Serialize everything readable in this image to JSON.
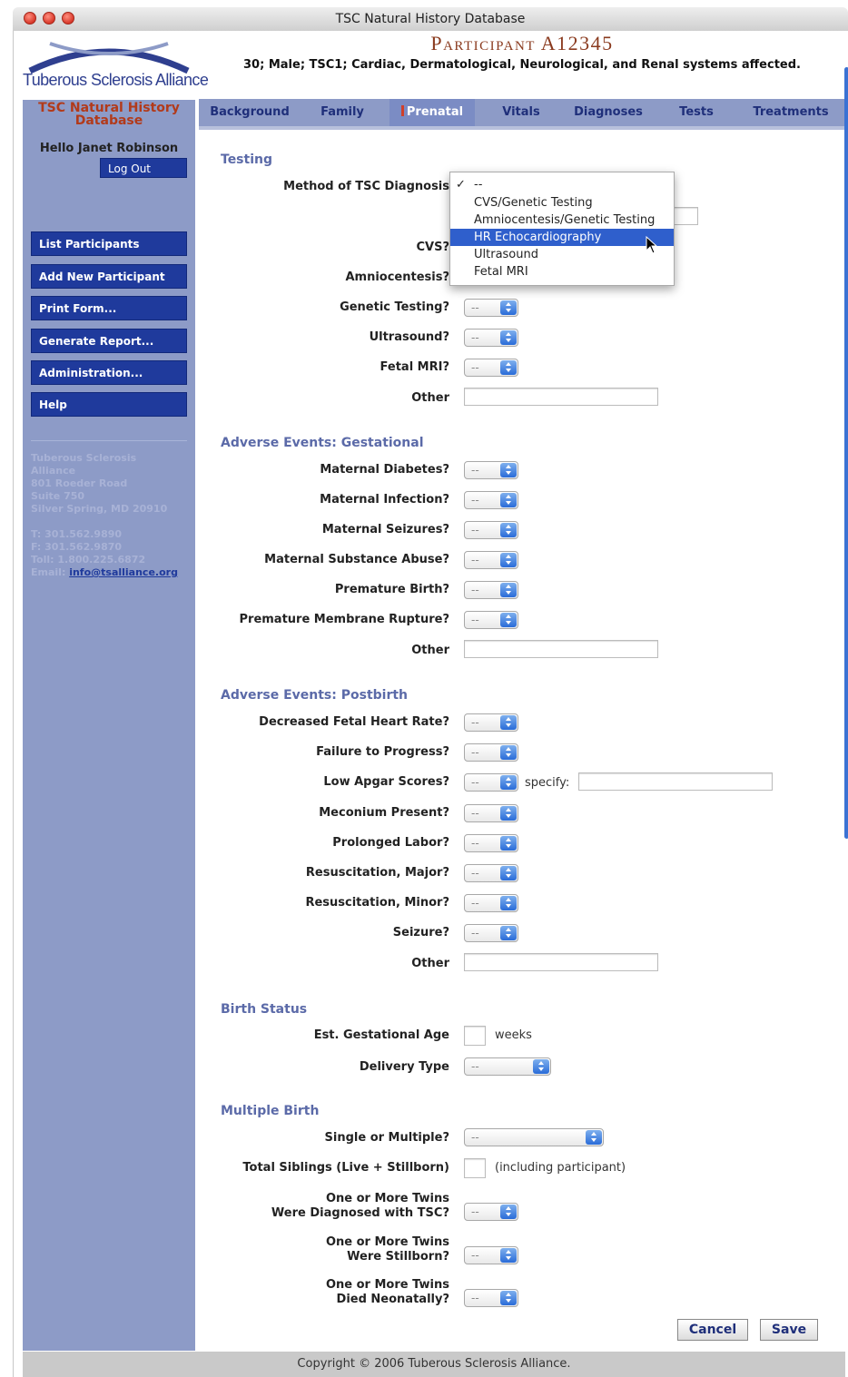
{
  "window": {
    "title": "TSC Natural History Database"
  },
  "header": {
    "logo_text": "Tuberous Sclerosis Alliance",
    "participant_title": "Participant A12345",
    "participant_summary": "30; Male; TSC1; Cardiac, Dermatological, Neurological, and Renal systems affected."
  },
  "sidebar": {
    "db_title_line1": "TSC Natural History",
    "db_title_line2": "Database",
    "hello": "Hello Janet Robinson",
    "logout": "Log Out",
    "nav": [
      "List Participants",
      "Add New Participant",
      "Print Form...",
      "Generate Report...",
      "Administration...",
      "Help"
    ],
    "address": {
      "line1": "Tuberous Sclerosis",
      "line2": "Alliance",
      "line3": "801 Roeder Road",
      "line4": "Suite 750",
      "line5": "Silver Spring, MD 20910",
      "phone": "T: 301.562.9890",
      "fax": "F: 301.562.9870",
      "tollfree": "Toll: 1.800.225.6872",
      "email_label": "Email:",
      "email": "info@tsalliance.org"
    }
  },
  "tabs": [
    "Background",
    "Family",
    "Prenatal",
    "Vitals",
    "Diagnoses",
    "Tests",
    "Treatments"
  ],
  "active_tab": "Prenatal",
  "select_default": "--",
  "sections": {
    "testing": {
      "title": "Testing",
      "method_label": "Method of TSC Diagnosis",
      "cvs": "CVS?",
      "amnio": "Amniocentesis?",
      "genetic": "Genetic Testing?",
      "ultrasound": "Ultrasound?",
      "fetal_mri": "Fetal MRI?",
      "other": "Other"
    },
    "gestational": {
      "title": "Adverse Events: Gestational",
      "diabetes": "Maternal Diabetes?",
      "infection": "Maternal Infection?",
      "seizures": "Maternal Seizures?",
      "substance": "Maternal Substance Abuse?",
      "premature": "Premature Birth?",
      "rupture": "Premature Membrane Rupture?",
      "other": "Other"
    },
    "postbirth": {
      "title": "Adverse Events: Postbirth",
      "heart": "Decreased Fetal Heart Rate?",
      "progress": "Failure to Progress?",
      "apgar": "Low Apgar Scores?",
      "specify": "specify:",
      "meconium": "Meconium Present?",
      "labor": "Prolonged Labor?",
      "resus_major": "Resuscitation, Major?",
      "resus_minor": "Resuscitation, Minor?",
      "seizure": "Seizure?",
      "other": "Other"
    },
    "birth_status": {
      "title": "Birth Status",
      "gest_age": "Est. Gestational Age",
      "weeks": "weeks",
      "delivery": "Delivery Type"
    },
    "multiple": {
      "title": "Multiple Birth",
      "single_multiple": "Single or Multiple?",
      "siblings": "Total Siblings (Live + Stillborn)",
      "including": "(including participant)",
      "twins_tsc_1": "One or More Twins",
      "twins_tsc_2": "Were Diagnosed with TSC?",
      "twins_still_1": "One or More Twins",
      "twins_still_2": "Were Stillborn?",
      "twins_neo_1": "One or More Twins",
      "twins_neo_2": "Died Neonatally?"
    }
  },
  "dropdown": {
    "options": [
      "--",
      "CVS/Genetic Testing",
      "Amniocentesis/Genetic Testing",
      "HR Echocardiography",
      "Ultrasound",
      "Fetal MRI"
    ],
    "checked": "--",
    "highlighted": "HR Echocardiography"
  },
  "buttons": {
    "cancel": "Cancel",
    "save": "Save"
  },
  "footer": "Copyright © 2006 Tuberous Sclerosis Alliance.",
  "colors": {
    "sidebar": "#8d9bc7",
    "nav_button": "#1f3a9c",
    "section_title": "#5b6aa8",
    "title_accent": "#8a3a1e",
    "highlight": "#2f5fcc"
  }
}
